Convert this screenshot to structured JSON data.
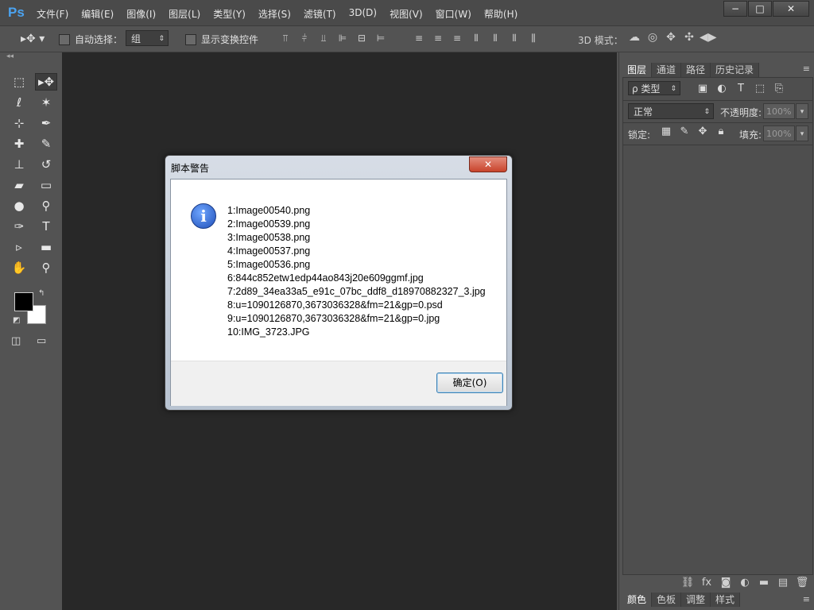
{
  "app": {
    "logo": "Ps"
  },
  "menu": {
    "items": [
      "文件(F)",
      "编辑(E)",
      "图像(I)",
      "图层(L)",
      "类型(Y)",
      "选择(S)",
      "滤镜(T)",
      "3D(D)",
      "视图(V)",
      "窗口(W)",
      "帮助(H)"
    ]
  },
  "window_controls": {
    "minimize": "−",
    "maximize": "□",
    "close": "✕"
  },
  "options": {
    "auto_select_label": "自动选择：",
    "group_value": "组",
    "show_transform_label": "显示变换控件",
    "mode_3d_label": "3D 模式："
  },
  "layers_panel": {
    "tabs": [
      "图层",
      "通道",
      "路径",
      "历史记录"
    ],
    "active_tab": "图层",
    "kind_label": "ρ 类型",
    "blend_mode": "正常",
    "opacity_label": "不透明度:",
    "opacity_value": "100%",
    "lock_label": "锁定:",
    "fill_label": "填充:",
    "fill_value": "100%"
  },
  "color_panel": {
    "tabs": [
      "颜色",
      "色板",
      "调整",
      "样式"
    ]
  },
  "dialog": {
    "title": "脚本警告",
    "close_label": "✕",
    "icon": "info-icon",
    "lines": [
      "1:Image00540.png",
      "2:Image00539.png",
      "3:Image00538.png",
      "4:Image00537.png",
      "5:Image00536.png",
      "6:844c852etw1edp44ao843j20e609ggmf.jpg",
      "7:2d89_34ea33a5_e91c_07bc_ddf8_d18970882327_3.jpg",
      "8:u=1090126870,3673036328&fm=21&gp=0.psd",
      "9:u=1090126870,3673036328&fm=21&gp=0.jpg",
      "10:IMG_3723.JPG"
    ],
    "ok_label": "确定(O)"
  }
}
